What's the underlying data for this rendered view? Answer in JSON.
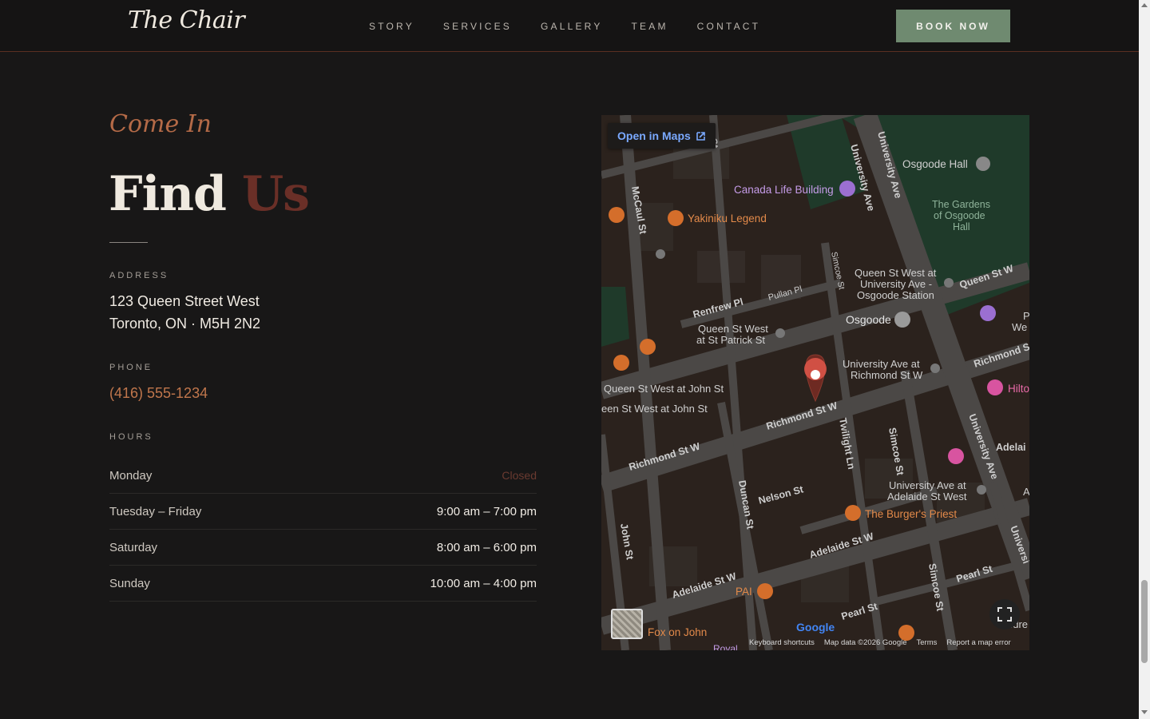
{
  "header": {
    "logo": "The Chair",
    "nav": [
      "STORY",
      "SERVICES",
      "GALLERY",
      "TEAM",
      "CONTACT"
    ],
    "book_label": "BOOK NOW"
  },
  "section": {
    "eyebrow": "Come In",
    "title_part1": "Find",
    "title_part2": "Us",
    "address_label": "ADDRESS",
    "address_line1": "123 Queen Street West",
    "address_line2": "Toronto, ON · M5H 2N2",
    "phone_label": "PHONE",
    "phone": "(416) 555-1234",
    "hours_label": "HOURS",
    "hours": [
      {
        "day": "Monday",
        "time": "Closed"
      },
      {
        "day": "Tuesday – Friday",
        "time": "9:00 am – 7:00 pm"
      },
      {
        "day": "Saturday",
        "time": "8:00 am – 6:00 pm"
      },
      {
        "day": "Sunday",
        "time": "10:00 am – 4:00 pm"
      }
    ]
  },
  "map": {
    "open_label": "Open in Maps",
    "google": "Google",
    "footer": [
      "Keyboard shortcuts",
      "Map data ©2026 Google",
      "Terms",
      "Report a map error"
    ],
    "streets": {
      "university_ave": "University Ave",
      "mccaul": "McCaul St",
      "simcoe": "Simcoe St",
      "renfrew": "Renfrew Pl",
      "pullan": "Pullan Pl",
      "queen_w": "Queen St W",
      "richmond_w1": "Richmond St W",
      "richmond_w2": "Richmond St W",
      "richmond_edge": "Richmond S",
      "adelaide_w1": "Adelaide St W",
      "adelaide_w2": "Adelaide St W",
      "adelaide_edge": "Adelai",
      "pearl1": "Pearl St",
      "pearl2": "Pearl St",
      "nelson": "Nelson St",
      "duncan": "Duncan St",
      "john": "John St",
      "twilight": "Twilight Ln",
      "simcoe2": "Simcoe St",
      "simcoe3": "Simcoe St",
      "university_ave2": "University Ave",
      "university_edge": "Universi",
      "university_ave3": "University Ave",
      "st_edge": "St"
    },
    "places": {
      "osgoode_hall": "Osgoode Hall",
      "gardens1": "The Gardens",
      "gardens2": "of Osgoode",
      "gardens3": "Hall",
      "canada_life": "Canada Life Building",
      "yakiniku": "Yakiniku Legend",
      "qs_univ1": "Queen St West at",
      "qs_univ2": "University Ave -",
      "qs_univ3": "Osgoode Station",
      "osgoode": "Osgoode",
      "qs_patrick1": "Queen St West",
      "qs_patrick2": "at St Patrick St",
      "univ_rich1": "University Ave at",
      "univ_rich2": "Richmond St W",
      "qs_john1": "Queen St West at John St",
      "qs_john2": "een St West at John St",
      "hilton": "Hilto",
      "univ_adel1": "University Ave at",
      "univ_adel2": "Adelaide St West",
      "burgers_priest": "The Burger's Priest",
      "pai": "PAI",
      "fox_on_john": "Fox on John",
      "royal": "Royal",
      "edge_p": "P",
      "edge_we": "We",
      "edge_a": "A",
      "edge_dre": "..dre"
    }
  },
  "colors": {
    "accent_copper": "#c0764c",
    "button_green": "#6f8a70",
    "title_red": "#6a2f27",
    "closed": "#6a3a30"
  }
}
